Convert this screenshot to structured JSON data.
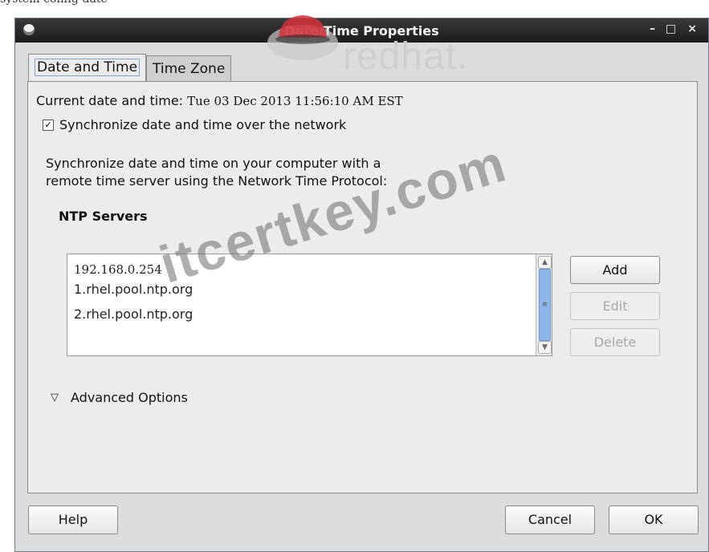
{
  "top_caption": "system-config-date",
  "window": {
    "title": "Date/Time Properties",
    "controls": {
      "minimize": "–",
      "maximize": "□",
      "close": "×"
    }
  },
  "logo": {
    "text": "redhat."
  },
  "tabs": [
    {
      "label": "Date and Time",
      "active": true
    },
    {
      "label": "Time Zone",
      "active": false
    }
  ],
  "date_time": {
    "current_label": "Current date and time:",
    "current_value": "Tue 03 Dec 2013 11:56:10 AM EST",
    "sync_checkbox": {
      "checked": true,
      "mark": "✓",
      "label": "Synchronize date and time over the network"
    },
    "description_line1": "Synchronize date and time on your computer with a",
    "description_line2": "remote time server using the Network Time Protocol:",
    "ntp_heading": "NTP Servers",
    "ntp_servers": [
      "192.168.0.254",
      "1.rhel.pool.ntp.org",
      "2.rhel.pool.ntp.org"
    ],
    "buttons": {
      "add": "Add",
      "edit": "Edit",
      "delete": "Delete"
    },
    "advanced_label": "Advanced Options",
    "advanced_glyph": "▽"
  },
  "footer": {
    "help": "Help",
    "cancel": "Cancel",
    "ok": "OK"
  },
  "watermark": "itcertkey.com",
  "colors": {
    "titlebar": "#232323",
    "scroll_thumb": "#8fb6e8",
    "window_bg": "#dcdcdc"
  }
}
